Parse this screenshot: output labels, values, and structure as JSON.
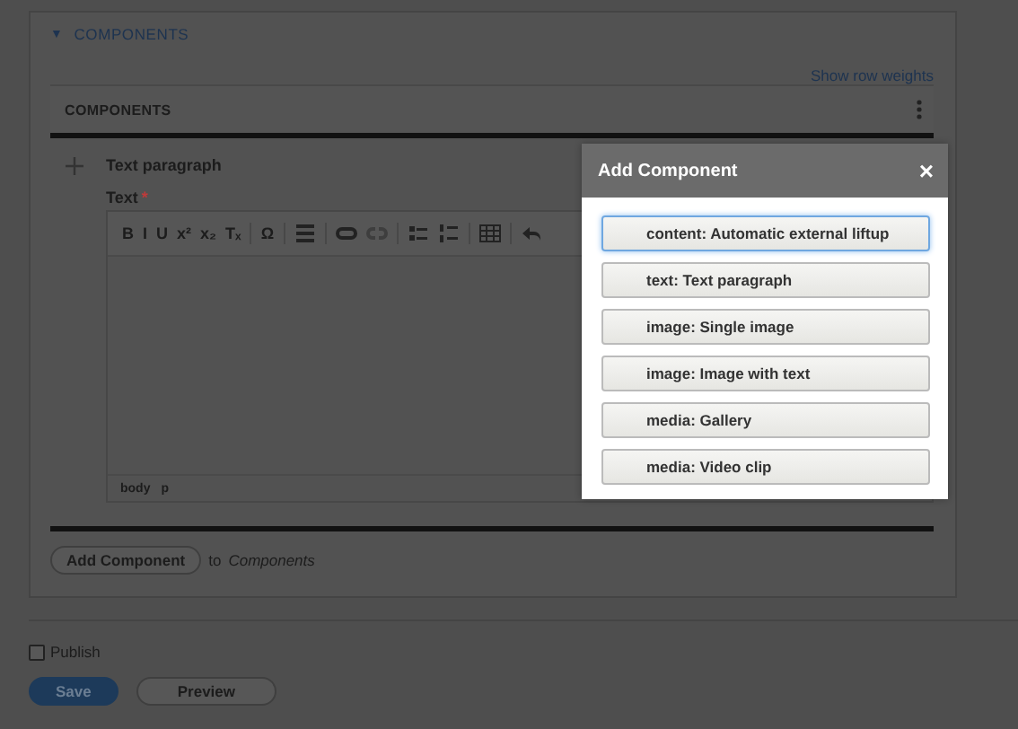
{
  "section": {
    "title": "COMPONENTS",
    "toggle": "▼"
  },
  "show_row_weights": "Show row weights",
  "table": {
    "header": "COMPONENTS",
    "rows": [
      {
        "title": "Text paragraph",
        "field": {
          "label": "Text",
          "required_mark": "*",
          "toolbar": [
            [
              {
                "kind": "glyph",
                "label": "B"
              },
              {
                "kind": "glyph",
                "label": "I"
              },
              {
                "kind": "glyph",
                "label": "U"
              },
              {
                "kind": "glyph",
                "label": "x²"
              },
              {
                "kind": "glyph",
                "label": "x₂"
              },
              {
                "kind": "glyph",
                "label": "Tₓ"
              }
            ],
            [
              {
                "kind": "glyph",
                "label": "Ω"
              }
            ],
            [
              {
                "kind": "rule"
              }
            ],
            [
              {
                "kind": "link"
              },
              {
                "kind": "unlink",
                "disabled": true
              }
            ],
            [
              {
                "kind": "bullets"
              },
              {
                "kind": "numbers"
              }
            ],
            [
              {
                "kind": "table"
              }
            ],
            [
              {
                "kind": "undo"
              }
            ]
          ],
          "path": [
            "body",
            "p"
          ]
        }
      }
    ]
  },
  "add_component": {
    "button": "Add Component",
    "to": "to",
    "target": "Components"
  },
  "publish": {
    "label": "Publish",
    "checked": false
  },
  "actions": [
    {
      "label": "Save",
      "kind": "primary"
    },
    {
      "label": "Preview",
      "kind": "secondary"
    }
  ],
  "dialog": {
    "title": "Add Component",
    "close": "×",
    "options": [
      {
        "label": "content: Automatic external liftup",
        "selected": true
      },
      {
        "label": "text: Text paragraph",
        "selected": false
      },
      {
        "label": "image: Single image",
        "selected": false
      },
      {
        "label": "image: Image with text",
        "selected": false
      },
      {
        "label": "media: Gallery",
        "selected": false
      },
      {
        "label": "media: Video clip",
        "selected": false
      }
    ]
  }
}
